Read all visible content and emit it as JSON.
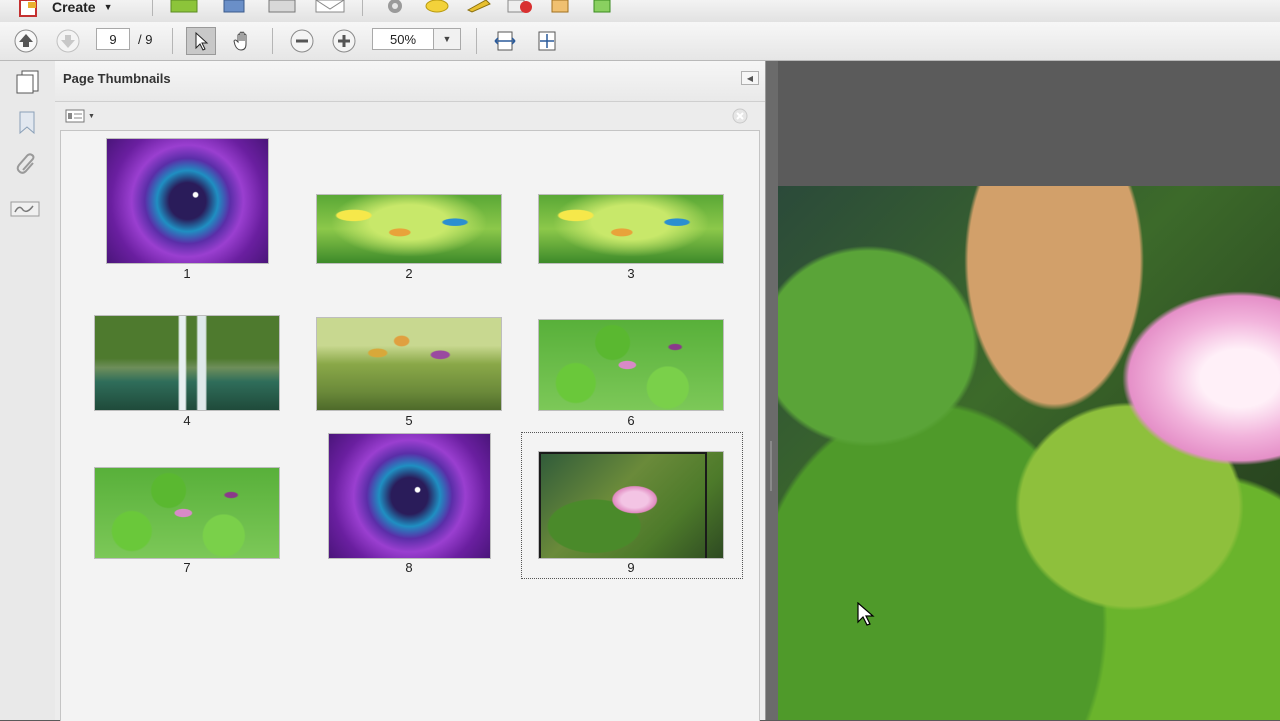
{
  "toolbar": {
    "create_label": "Create",
    "page_current": "9",
    "page_total": "/ 9",
    "zoom_value": "50%"
  },
  "panel": {
    "title": "Page Thumbnails"
  },
  "thumbnails": [
    {
      "label": "1",
      "image": "galaxy"
    },
    {
      "label": "2",
      "image": "hummingbirds"
    },
    {
      "label": "3",
      "image": "hummingbirds"
    },
    {
      "label": "4",
      "image": "waterfall"
    },
    {
      "label": "5",
      "image": "lotus-buds"
    },
    {
      "label": "6",
      "image": "lily-pads"
    },
    {
      "label": "7",
      "image": "lily-pads"
    },
    {
      "label": "8",
      "image": "galaxy"
    },
    {
      "label": "9",
      "image": "lotus-flower",
      "selected": true
    }
  ],
  "icons": {
    "create": "create-icon",
    "open": "folder-icon",
    "save": "save-icon",
    "print": "print-icon",
    "email": "email-icon",
    "settings": "gear-icon",
    "comment": "comment-icon",
    "sign": "sign-icon",
    "redact": "redact-icon",
    "share": "share-icon",
    "export": "export-icon"
  },
  "colors": {
    "panel_bg": "#ededed",
    "doc_bg": "#5b5b5b",
    "selection": "#555555"
  }
}
